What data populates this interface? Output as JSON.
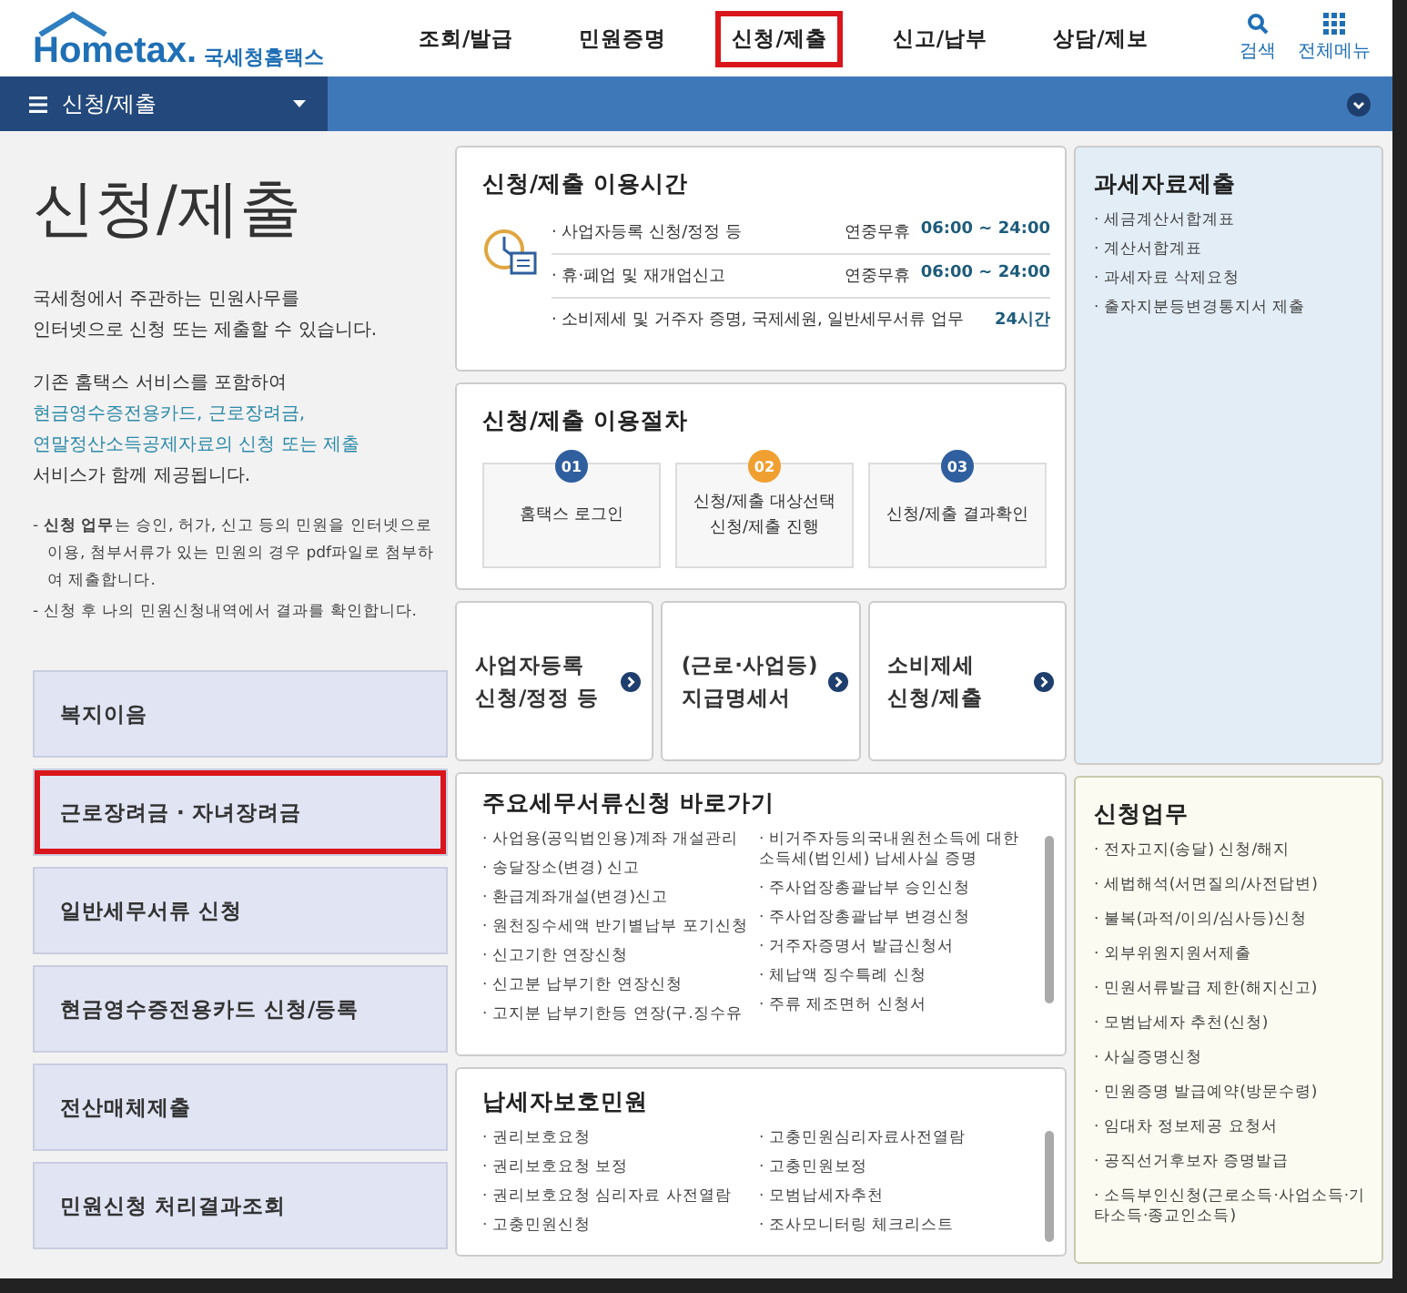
{
  "header": {
    "logo": "Hometax.",
    "logo_sub": "국세청홈택스",
    "nav": [
      {
        "label": "조회/발급",
        "selected": false
      },
      {
        "label": "민원증명",
        "selected": false
      },
      {
        "label": "신청/제출",
        "selected": true
      },
      {
        "label": "신고/납부",
        "selected": false
      },
      {
        "label": "상담/제보",
        "selected": false
      }
    ],
    "search": "검색",
    "all_menu": "전체메뉴"
  },
  "breadcrumb": {
    "label": "신청/제출"
  },
  "intro": {
    "title": "신청/제출",
    "lines": [
      "국세청에서 주관하는 민원사무를",
      "인터넷으로 신청 또는 제출할 수 있습니다."
    ],
    "lines2": [
      {
        "text": "기존 홈택스 서비스를 포함하여",
        "kind": "plain"
      },
      {
        "text": "현금영수증전용카드, 근로장려금,",
        "kind": "link"
      },
      {
        "text": "연말정산소득공제자료의 신청 또는 제출",
        "kind": "link"
      },
      {
        "text": "서비스가 함께 제공됩니다.",
        "kind": "plain"
      }
    ],
    "notes": [
      "- **신청 업무**는 승인, 허가, 신고 등의 민원을 인터넷으로 이용, 첨부서류가 있는 민원의 경우 pdf파일로 첨부하여 제출합니다.",
      "- 신청 후 나의 민원신청내역에서 결과를 확인합니다."
    ]
  },
  "side_menu": [
    {
      "label": "복지이음",
      "highlighted": false
    },
    {
      "label": "근로장려금 · 자녀장려금",
      "highlighted": true
    },
    {
      "label": "일반세무서류 신청",
      "highlighted": false
    },
    {
      "label": "현금영수증전용카드 신청/등록",
      "highlighted": false
    },
    {
      "label": "전산매체제출",
      "highlighted": false
    },
    {
      "label": "민원신청 처리결과조회",
      "highlighted": false
    }
  ],
  "hours": {
    "title": "신청/제출 이용시간",
    "rows": [
      {
        "label": "· 사업자등록 신청/정정 등",
        "prefix": "연중무휴",
        "time": "06:00 ~ 24:00"
      },
      {
        "label": "· 휴·폐업 및 재개업신고",
        "prefix": "연중무휴",
        "time": "06:00 ~ 24:00"
      },
      {
        "label": "· 소비제세 및 거주자 증명, 국제세원, 일반세무서류 업무",
        "prefix": "",
        "time": "24시간"
      }
    ]
  },
  "procedure": {
    "title": "신청/제출 이용절차",
    "steps": [
      {
        "num": "01",
        "text": "홈택스 로그인",
        "color": "#2f5f9e"
      },
      {
        "num": "02",
        "text": "신청/제출 대상선택 신청/제출 진행",
        "color": "#f0a030"
      },
      {
        "num": "03",
        "text": "신청/제출 결과확인",
        "color": "#2f5f9e"
      }
    ]
  },
  "quick_links": [
    "사업자등록\n신청/정정 등",
    "(근로·사업등)\n지급명세서",
    "소비제세\n신청/제출"
  ],
  "tax_data": {
    "title": "과세자료제출",
    "items": [
      "· 세금계산서합계표",
      "· 계산서합계표",
      "· 과세자료 삭제요청",
      "· 출자지분등변경통지서 제출"
    ]
  },
  "shortcuts": {
    "title": "주요세무서류신청 바로가기",
    "col1": [
      "· 사업용(공익법인용)계좌 개설관리",
      "· 송달장소(변경) 신고",
      "· 환급계좌개설(변경)신고",
      "· 원천징수세액 반기별납부 포기신청",
      "· 신고기한 연장신청",
      "· 신고분 납부기한 연장신청",
      "· 고지분 납부기한등 연장(구.징수유"
    ],
    "col2": [
      "· 비거주자등의국내원천소득에 대한 소득세(법인세) 납세사실 증명",
      "· 주사업장총괄납부 승인신청",
      "· 주사업장총괄납부 변경신청",
      "· 거주자증명서 발급신청서",
      "· 체납액 징수특례 신청",
      "· 주류 제조면허 신청서"
    ]
  },
  "protection": {
    "title": "납세자보호민원",
    "col1": [
      "· 권리보호요청",
      "· 권리보호요청 보정",
      "· 권리보호요청 심리자료 사전열람",
      "· 고충민원신청"
    ],
    "col2": [
      "· 고충민원심리자료사전열람",
      "· 고충민원보정",
      "· 모범납세자추천",
      "· 조사모니터링 체크리스트"
    ]
  },
  "apply": {
    "title": "신청업무",
    "items": [
      "· 전자고지(송달) 신청/해지",
      "· 세법해석(서면질의/사전답변)",
      "· 불복(과적/이의/심사등)신청",
      "· 외부위원지원서제출",
      "· 민원서류발급 제한(해지신고)",
      "· 모범납세자 추천(신청)",
      "· 사실증명신청",
      "· 민원증명 발급예약(방문수령)",
      "· 임대차 정보제공 요청서",
      "· 공직선거후보자 증명발급",
      "· 소득부인신청(근로소득·사업소득·기타소득·종교인소득)"
    ]
  }
}
